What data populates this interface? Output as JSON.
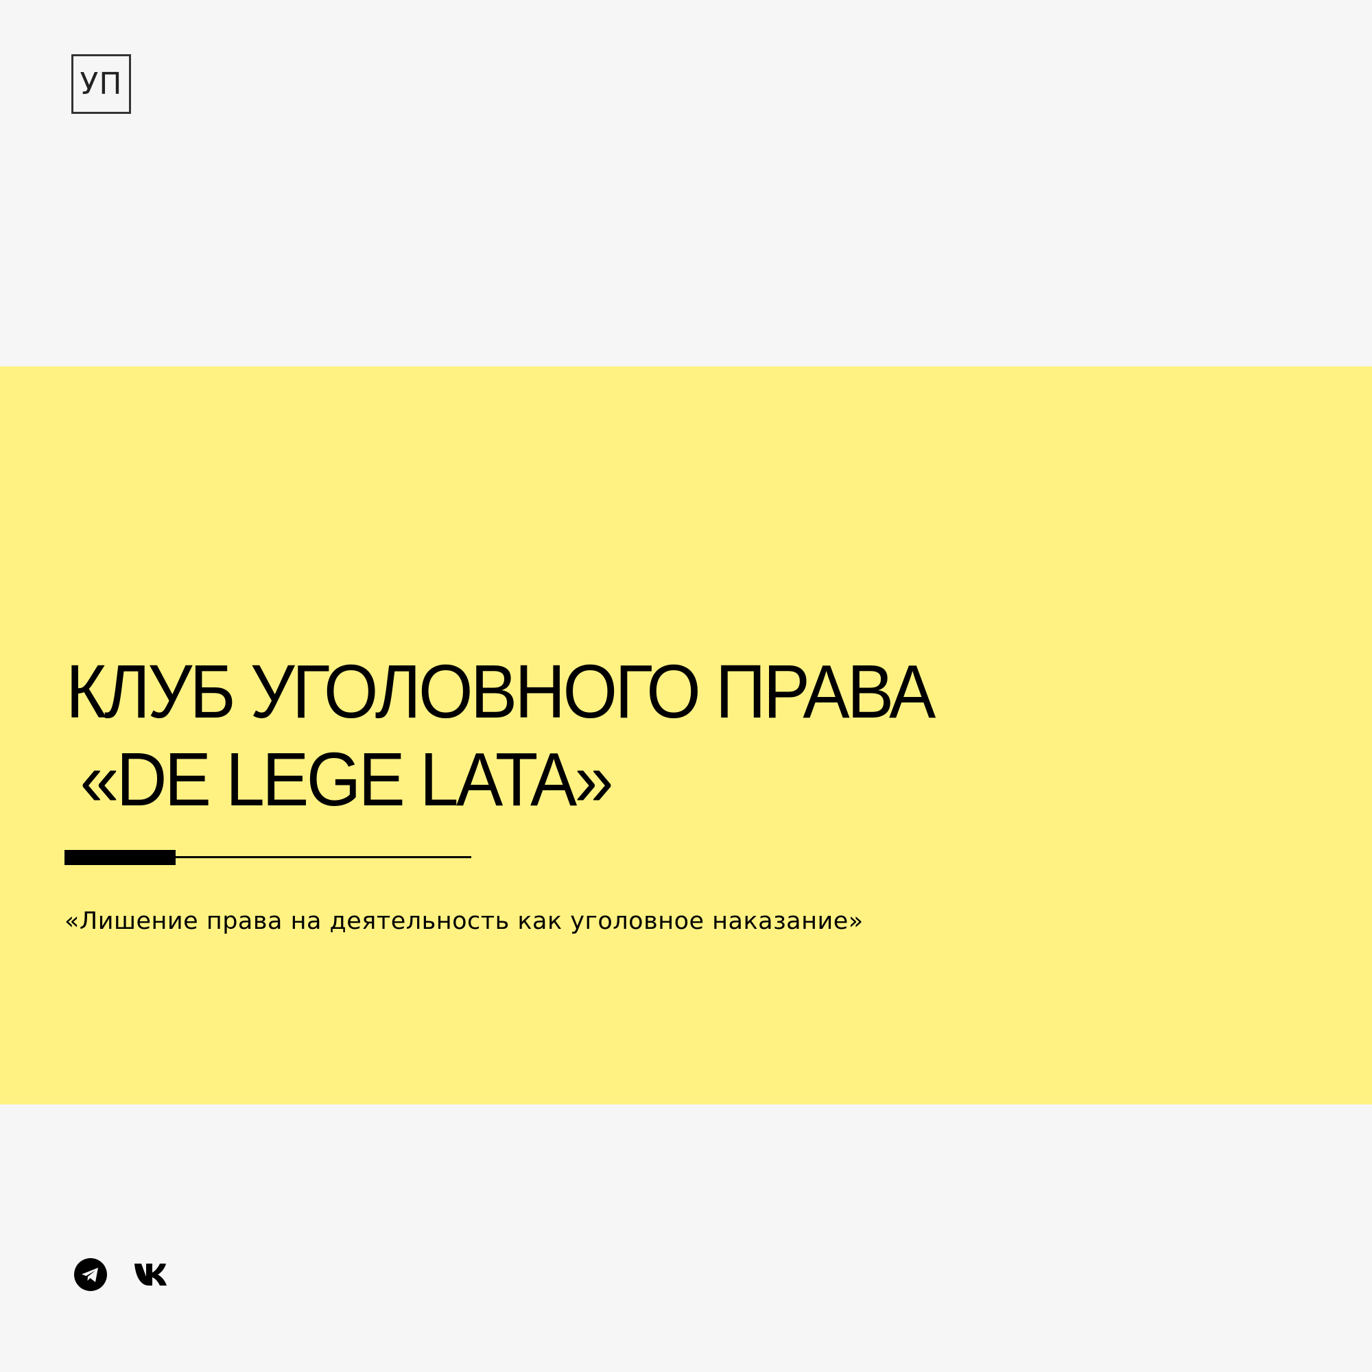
{
  "logo": {
    "text": "УП"
  },
  "title": {
    "line1": "КЛУБ УГОЛОВНОГО ПРАВА",
    "line2": "«DE LEGE LATA»"
  },
  "subtitle": "«Лишение права на деятельность как уголовное наказание»",
  "colors": {
    "background": "#f6f6f6",
    "band": "#fff282",
    "text": "#000000"
  },
  "social": {
    "icons": [
      "telegram-icon",
      "vk-icon"
    ]
  }
}
